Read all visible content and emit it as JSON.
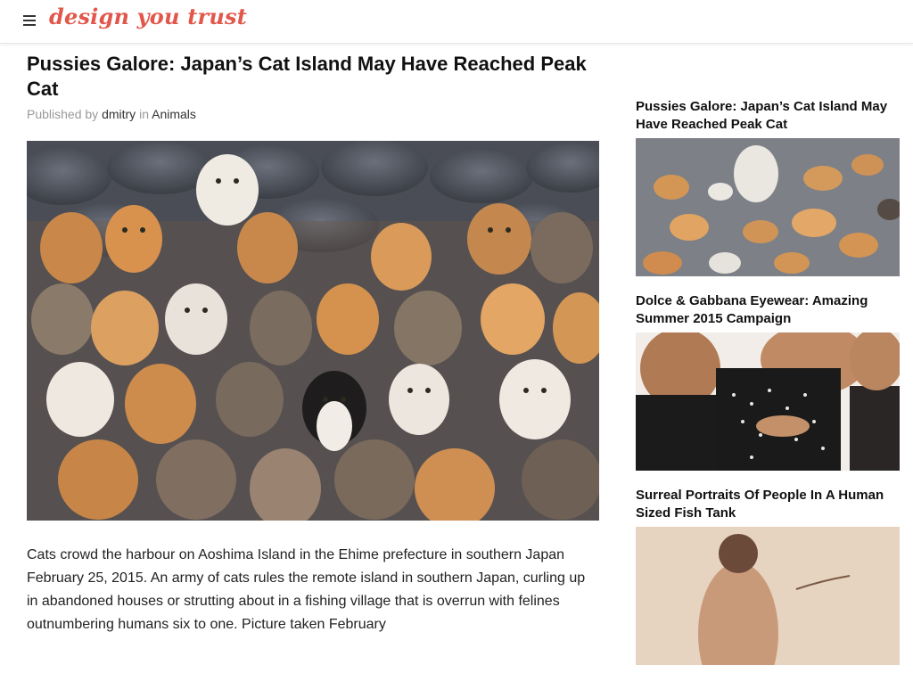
{
  "header": {
    "logo": "design you trust",
    "menu_icon": "hamburger-menu-icon"
  },
  "article": {
    "title": "Pussies Galore: Japan’s Cat Island May Have Reached Peak Cat",
    "byline_prefix": "Published by",
    "author": "dmitry",
    "byline_in": "in",
    "category": "Animals",
    "body": "Cats crowd the harbour on Aoshima Island in the Ehime prefecture in southern Japan February 25, 2015. An army of cats rules the remote island in southern Japan, curling up in abandoned houses or strutting about in a fishing village that is overrun with felines outnumbering humans six to one. Picture taken February"
  },
  "sidebar": {
    "items": [
      {
        "title": "Pussies Galore: Japan’s Cat Island May Have Reached Peak Cat"
      },
      {
        "title": "Dolce & Gabbana Eyewear: Amazing Summer 2015 Campaign"
      },
      {
        "title": "Surreal Portraits Of People In A Human Sized Fish Tank"
      }
    ]
  },
  "colors": {
    "logo": "#e2574c",
    "text": "#111111",
    "muted": "#999999"
  }
}
